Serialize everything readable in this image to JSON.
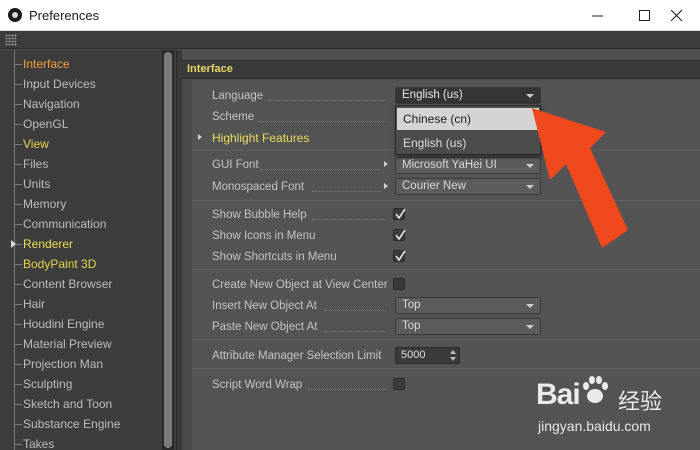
{
  "window": {
    "title": "Preferences"
  },
  "sidebar": {
    "items": [
      {
        "label": "Interface",
        "style": "orange"
      },
      {
        "label": "Input Devices",
        "style": "normal"
      },
      {
        "label": "Navigation",
        "style": "normal"
      },
      {
        "label": "OpenGL",
        "style": "normal"
      },
      {
        "label": "View",
        "style": "yellow"
      },
      {
        "label": "Files",
        "style": "normal"
      },
      {
        "label": "Units",
        "style": "normal"
      },
      {
        "label": "Memory",
        "style": "normal"
      },
      {
        "label": "Communication",
        "style": "normal"
      },
      {
        "label": "Renderer",
        "style": "bold"
      },
      {
        "label": "BodyPaint 3D",
        "style": "yellow"
      },
      {
        "label": "Content Browser",
        "style": "normal"
      },
      {
        "label": "Hair",
        "style": "normal"
      },
      {
        "label": "Houdini Engine",
        "style": "normal"
      },
      {
        "label": "Material Preview",
        "style": "normal"
      },
      {
        "label": "Projection Man",
        "style": "normal"
      },
      {
        "label": "Sculpting",
        "style": "normal"
      },
      {
        "label": "Sketch and Toon",
        "style": "normal"
      },
      {
        "label": "Substance Engine",
        "style": "normal"
      },
      {
        "label": "Takes",
        "style": "normal"
      }
    ]
  },
  "main": {
    "section_title": "Interface",
    "language": {
      "label": "Language",
      "value": "English (us)"
    },
    "scheme": {
      "label": "Scheme"
    },
    "highlight_features": {
      "label": "Highlight Features"
    },
    "gui_font": {
      "label": "GUI Font",
      "value": "Microsoft YaHei UI"
    },
    "mono_font": {
      "label": "Monospaced Font",
      "value": "Courier New"
    },
    "show_bubble_help": {
      "label": "Show Bubble Help",
      "checked": true
    },
    "show_icons_in_menu": {
      "label": "Show Icons in Menu",
      "checked": true
    },
    "show_shortcuts_in_menu": {
      "label": "Show Shortcuts in Menu",
      "checked": true
    },
    "create_at_view_center": {
      "label": "Create New Object at View Center",
      "checked": false
    },
    "insert_new_object_at": {
      "label": "Insert New Object At",
      "value": "Top"
    },
    "paste_new_object_at": {
      "label": "Paste New Object At",
      "value": "Top"
    },
    "attr_selection_limit": {
      "label": "Attribute Manager Selection Limit",
      "value": "5000"
    },
    "script_word_wrap": {
      "label": "Script Word Wrap",
      "checked": false
    }
  },
  "language_dropdown": {
    "options": [
      "Chinese (cn)",
      "English (us)"
    ],
    "highlighted": "Chinese (cn)"
  },
  "annotation": {
    "color": "#f0491e",
    "icon": "arrow-pointer-icon"
  },
  "watermark": {
    "logo_text": "Bai",
    "logo_text_2": "经验",
    "url": "jingyan.baidu.com"
  }
}
